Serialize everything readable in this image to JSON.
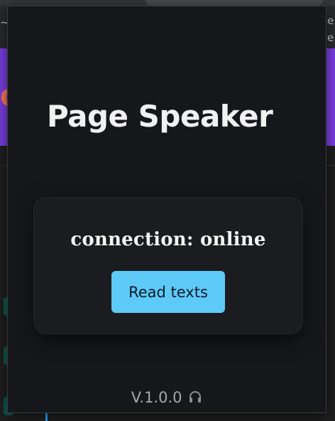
{
  "popup": {
    "title": "Page Speaker",
    "status_text": "connection: online",
    "read_button_label": "Read texts",
    "version": "V.1.0.0",
    "footer_icon": "headphones-icon"
  },
  "colors": {
    "popup_background": "#16171b",
    "card_background": "#1b1c20",
    "button_accent": "#5ecaf8",
    "text_primary": "#f1f1f1",
    "text_muted": "#a8a8ac",
    "background_banner": "#7b3fe4"
  }
}
